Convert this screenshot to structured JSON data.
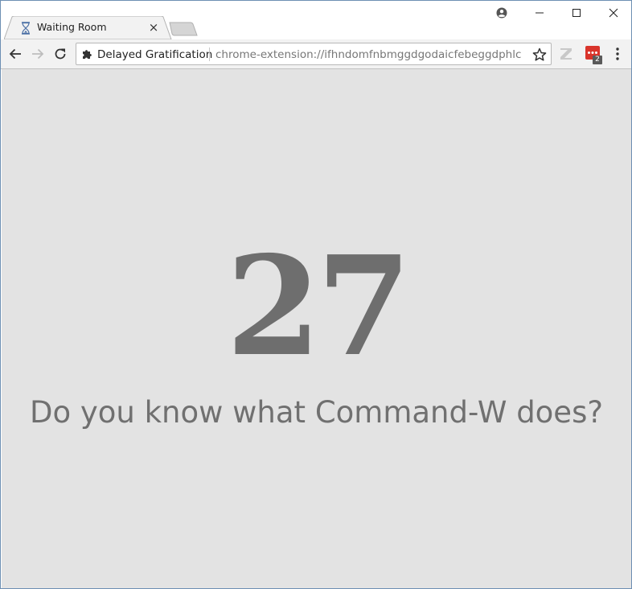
{
  "tab": {
    "title": "Waiting Room",
    "close_glyph": "×",
    "favicon": "hourglass-icon"
  },
  "toolbar": {
    "site_name": "Delayed Gratification",
    "url": "chrome-extension://ifhndomfnbmggdgodaicfebeggdphlcn/...",
    "badge_count": "2"
  },
  "page": {
    "counter": "27",
    "message": "Do you know what Command-W does?"
  },
  "colors": {
    "content_bg": "#e3e3e3",
    "text": "#6e6e6e",
    "extension_red": "#d9342b"
  }
}
